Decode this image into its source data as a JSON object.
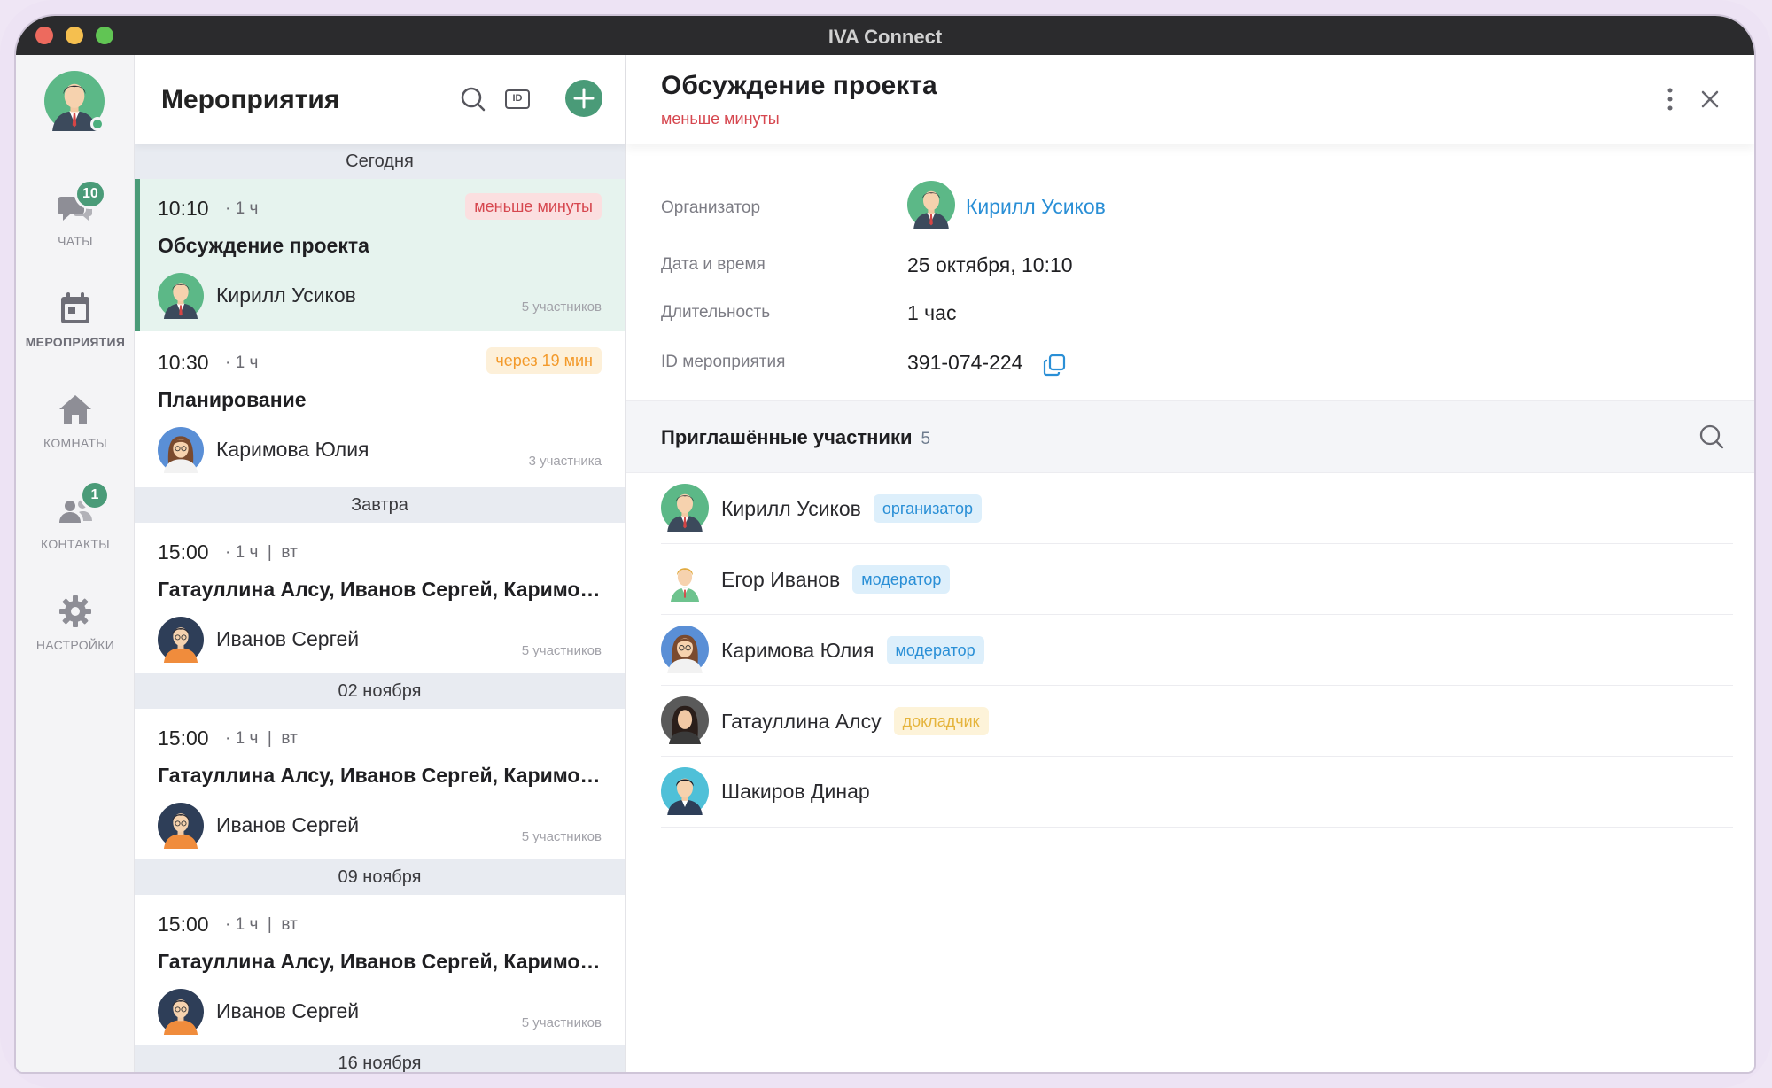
{
  "window": {
    "title": "IVA Connect"
  },
  "nav": {
    "items": [
      {
        "label": "ЧАТЫ",
        "badge": "10"
      },
      {
        "label": "МЕРОПРИЯТИЯ",
        "badge": ""
      },
      {
        "label": "КОМНАТЫ",
        "badge": ""
      },
      {
        "label": "КОНТАКТЫ",
        "badge": "1"
      },
      {
        "label": "НАСТРОЙКИ",
        "badge": ""
      }
    ]
  },
  "events": {
    "title": "Мероприятия",
    "id_button": "ID",
    "sections": [
      {
        "label": "Сегодня"
      },
      {
        "label": "Завтра"
      },
      {
        "label": "02 ноября"
      },
      {
        "label": "09 ноября"
      },
      {
        "label": "16 ноября"
      }
    ],
    "items": [
      {
        "time": "10:10",
        "duration": "· 1 ч",
        "tag": "меньше минуты",
        "title": "Обсуждение проекта",
        "owner": "Кирилл Усиков",
        "count": "5 участников"
      },
      {
        "time": "10:30",
        "duration": "· 1 ч",
        "tag": "через 19 мин",
        "title": "Планирование",
        "owner": "Каримова Юлия",
        "count": "3 участника"
      },
      {
        "time": "15:00",
        "duration": "· 1 ч  |  вт",
        "tag": "",
        "title": "Гатауллина Алсу, Иванов Сергей, Каримов...",
        "owner": "Иванов Сергей",
        "count": "5 участников"
      },
      {
        "time": "15:00",
        "duration": "· 1 ч  |  вт",
        "tag": "",
        "title": "Гатауллина Алсу, Иванов Сергей, Каримов...",
        "owner": "Иванов Сергей",
        "count": "5 участников"
      },
      {
        "time": "15:00",
        "duration": "· 1 ч  |  вт",
        "tag": "",
        "title": "Гатауллина Алсу, Иванов Сергей, Каримов...",
        "owner": "Иванов Сергей",
        "count": "5 участников"
      }
    ]
  },
  "detail": {
    "title": "Обсуждение проекта",
    "subtitle": "меньше минуты",
    "organizer_label": "Организатор",
    "organizer": "Кирилл Усиков",
    "date_label": "Дата и время",
    "date": "25 октября, 10:10",
    "duration_label": "Длительность",
    "duration": "1 час",
    "id_label": "ID мероприятия",
    "id": "391-074-224",
    "participants_title": "Приглашённые участники",
    "participants_count": "5",
    "participants": [
      {
        "name": "Кирилл Усиков",
        "role": "организатор"
      },
      {
        "name": "Егор Иванов",
        "role": "модератор"
      },
      {
        "name": "Каримова Юлия",
        "role": "модератор"
      },
      {
        "name": "Гатауллина Алсу",
        "role": "докладчик"
      },
      {
        "name": "Шакиров Динар",
        "role": ""
      }
    ]
  },
  "colors": {
    "accent": "#4a9b78",
    "link": "#2a8fd6",
    "alert": "#d6474f",
    "warning": "#f39a2b"
  }
}
